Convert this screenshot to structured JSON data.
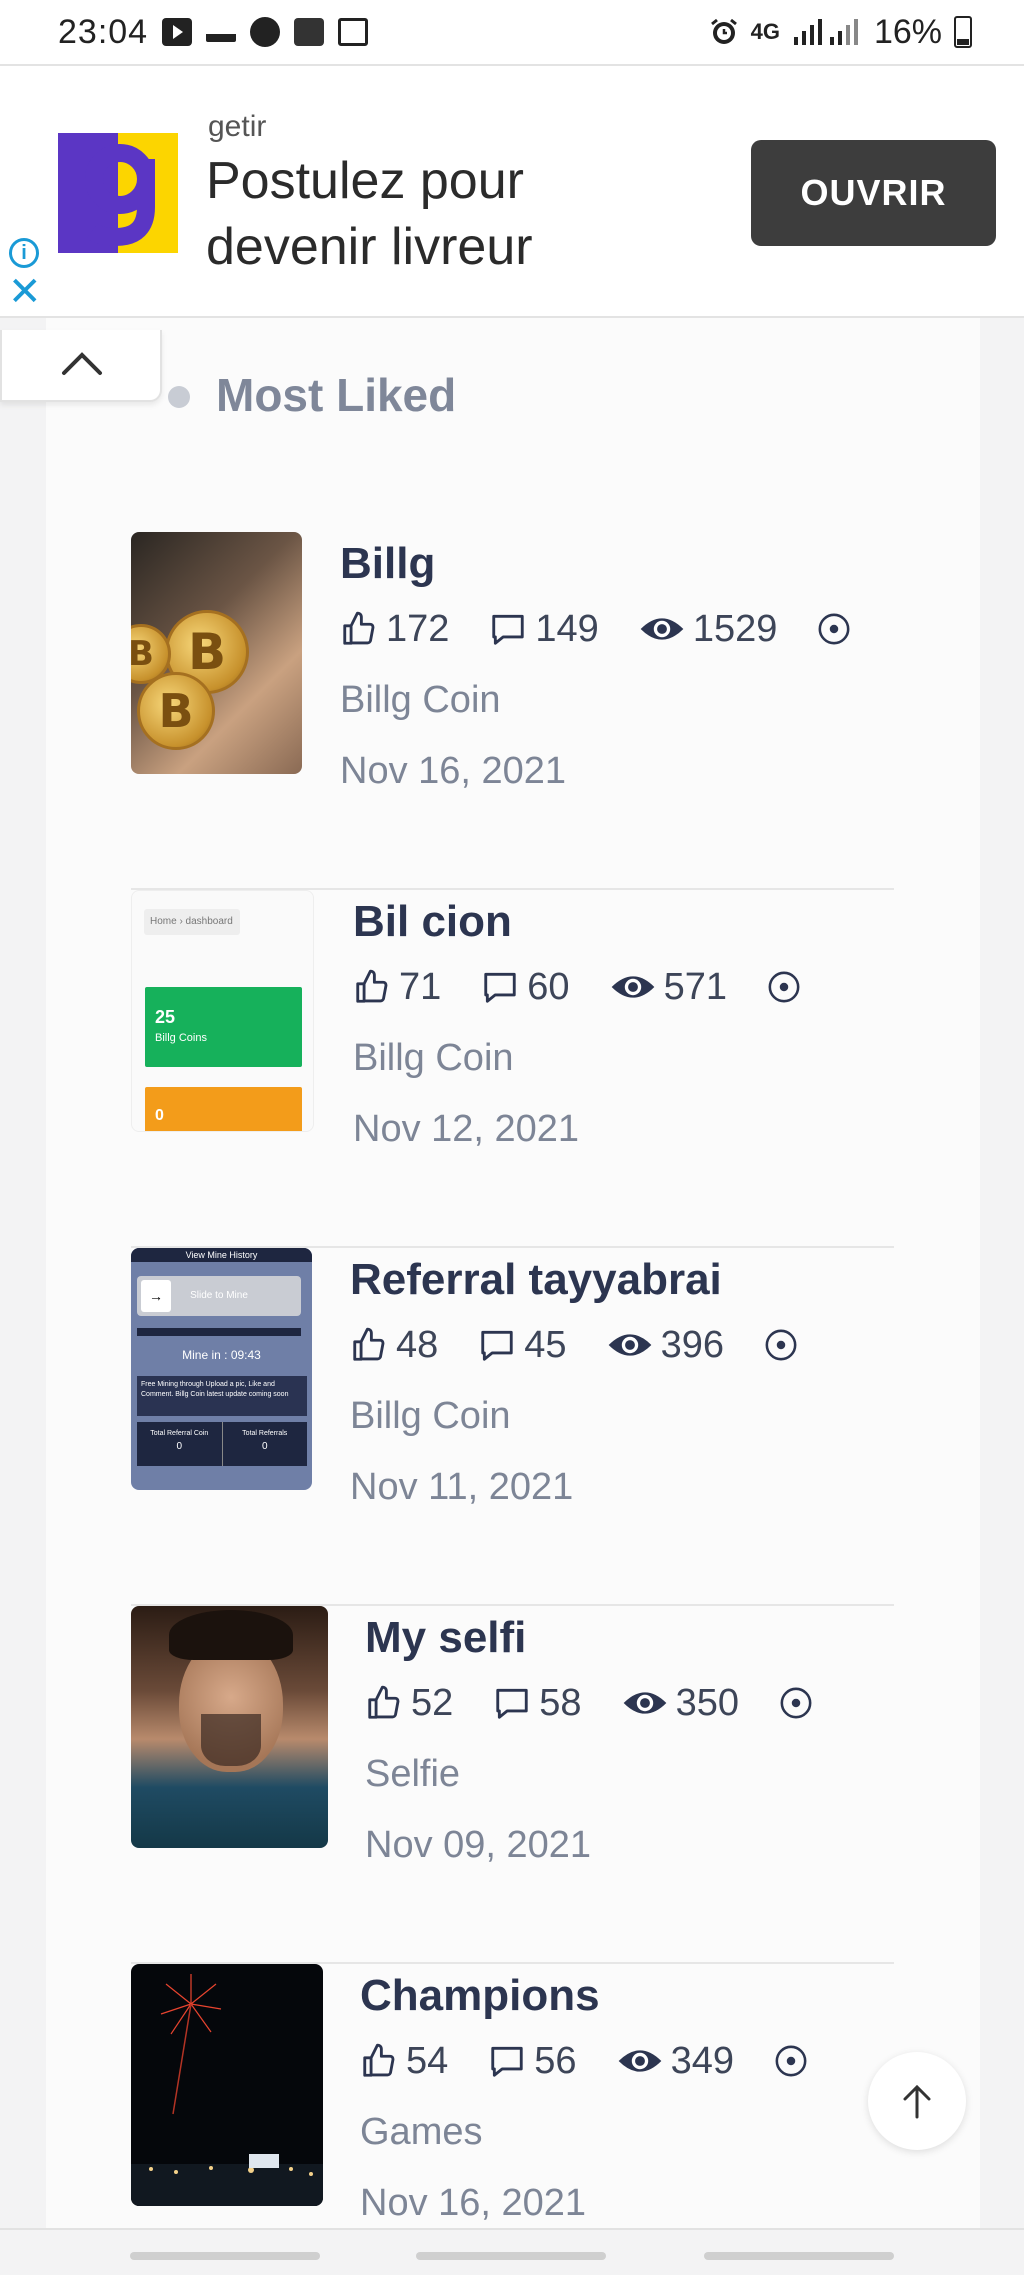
{
  "status_bar": {
    "time": "23:04",
    "network": "4G",
    "battery": "16%",
    "icons": [
      "youtube-icon",
      "tray-icon",
      "circle-app-icon",
      "app-icon",
      "gallery-icon",
      "alarm-icon",
      "signal-icon",
      "battery-icon"
    ]
  },
  "ad": {
    "brand": "getir",
    "headline": "Postulez pour devenir livreur",
    "button_label": "OUVRIR",
    "logo_letter": "g",
    "info_glyph": "i",
    "close_glyph": "✕",
    "colors": {
      "logo_purple": "#5b36c4",
      "logo_yellow": "#fcd500",
      "button": "#3d3d3d",
      "info": "#1a9ad6"
    }
  },
  "section": {
    "title": "Most Liked"
  },
  "posts": [
    {
      "title": "Billg",
      "likes": "172",
      "comments": "149",
      "views": "1529",
      "category": "Billg Coin",
      "date": "Nov 16, 2021"
    },
    {
      "title": "Bil cion",
      "likes": "71",
      "comments": "60",
      "views": "571",
      "category": "Billg Coin",
      "date": "Nov 12, 2021"
    },
    {
      "title": "Referral tayyabrai",
      "likes": "48",
      "comments": "45",
      "views": "396",
      "category": "Billg Coin",
      "date": "Nov 11, 2021"
    },
    {
      "title": "My selfi",
      "likes": "52",
      "comments": "58",
      "views": "350",
      "category": "Selfie",
      "date": "Nov 09, 2021"
    },
    {
      "title": "Champions",
      "likes": "54",
      "comments": "56",
      "views": "349",
      "category": "Games",
      "date": "Nov 16, 2021"
    }
  ],
  "thumbs": {
    "coin_letter": "B",
    "dashboard": {
      "breadcrumb": "Home › dashboard",
      "green_value": "25",
      "green_label": "Billg Coins",
      "orange_value": "0"
    },
    "referral": {
      "header": "View Mine History",
      "slide": "Slide to Mine",
      "timer": "Mine in : 09:43",
      "note": "Free Mining through Upload a pic, Like and Comment. Billg Coin latest update coming soon",
      "left_label": "Total Referral Coin",
      "left_value": "0",
      "right_label": "Total Referrals",
      "right_value": "0"
    }
  }
}
